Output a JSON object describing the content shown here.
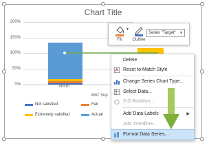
{
  "chart": {
    "title": "Chart Title",
    "y_ticks": [
      "200%",
      "150%",
      "100%",
      "50%",
      "0%"
    ],
    "categories": [
      "North",
      "ABC Sup"
    ],
    "legend": [
      "Not satisfied",
      "Fair",
      "Extremely satisfied",
      "Actual"
    ]
  },
  "chart_data": {
    "type": "bar",
    "stacked": true,
    "categories": [
      "North"
    ],
    "series": [
      {
        "name": "Not satisfied",
        "values": [
          0.05
        ]
      },
      {
        "name": "Fair",
        "values": [
          0.05
        ]
      },
      {
        "name": "Extremely satisfied",
        "values": [
          0.07
        ]
      },
      {
        "name": "Actual",
        "values": [
          1.18
        ]
      }
    ],
    "ylim": [
      0,
      2
    ],
    "colors": [
      "#4472c4",
      "#ed7d31",
      "#ffc000",
      "#5b9bd5",
      "#a5a5a5",
      "#70ad47"
    ]
  },
  "toolbar": {
    "fill_label": "Fill",
    "outline_label": "Outline",
    "series_select": "Series \"Target\""
  },
  "menu": {
    "items": [
      {
        "label": "Delete"
      },
      {
        "label": "Reset to Match Style"
      },
      {
        "label": "Change Series Chart Type..."
      },
      {
        "label": "Select Data..."
      },
      {
        "label": "3-D Rotation..."
      },
      {
        "label": "Add Data Labels"
      },
      {
        "label": "Add Trendline..."
      },
      {
        "label": "Format Data Series..."
      }
    ]
  }
}
